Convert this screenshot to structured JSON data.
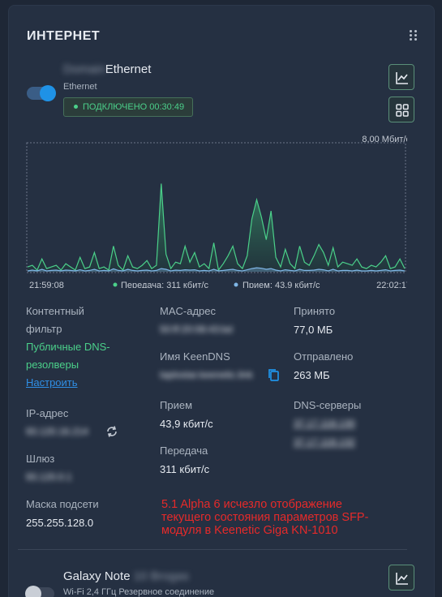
{
  "header": {
    "title": "ИНТЕРНЕТ",
    "menu_icon": "drag-handle-icon"
  },
  "connection": {
    "name_hidden": "Domain",
    "name": "Ethernet",
    "type": "Ethernet",
    "status": "ПОДКЛЮЧЕНО 00:30:49",
    "toggle_on": true,
    "colors": {
      "accent": "#1f92e6",
      "status": "#4bd08a",
      "rx": "#7fb6e6"
    }
  },
  "chart_data": {
    "type": "area",
    "max_label": "8,00 Мбит/с",
    "time_start": "21:59:08",
    "time_end": "22:02:17",
    "legend_tx": "Передача: 311 кбит/с",
    "legend_rx": "Прием: 43,9 кбит/с",
    "series": [
      {
        "name": "Передача",
        "color": "#4bd08a",
        "values": [
          0.3,
          0.4,
          0.1,
          0.8,
          0.2,
          0.3,
          0.4,
          0.1,
          0.5,
          0.3,
          0.1,
          0.9,
          0.2,
          0.3,
          1.2,
          0.2,
          0.3,
          0.1,
          1.6,
          0.4,
          0.1,
          1.0,
          0.3,
          0.2,
          0.4,
          0.7,
          0.2,
          0.4,
          5.5,
          1.1,
          0.2,
          0.6,
          0.5,
          1.6,
          0.6,
          1.2,
          0.3,
          0.5,
          0.2,
          1.8,
          0.1,
          0.5,
          1.0,
          1.6,
          0.5,
          0.2,
          1.0,
          3.3,
          4.5,
          3.4,
          2.0,
          3.8,
          0.9,
          0.3,
          1.4,
          0.5,
          0.2,
          1.6,
          0.6,
          0.4,
          1.0,
          1.7,
          1.2,
          0.4,
          1.5,
          0.3,
          0.6,
          0.5,
          0.4,
          0.8,
          0.3,
          0.2,
          0.4,
          0.3,
          0.6,
          1.0,
          0.2,
          0.3,
          0.8,
          0.2
        ]
      },
      {
        "name": "Прием",
        "color": "#7fb6e6",
        "values": [
          0.05,
          0.1,
          0.05,
          0.15,
          0.05,
          0.08,
          0.1,
          0.05,
          0.1,
          0.08,
          0.05,
          0.12,
          0.05,
          0.08,
          0.15,
          0.05,
          0.08,
          0.05,
          0.18,
          0.08,
          0.05,
          0.15,
          0.08,
          0.05,
          0.08,
          0.1,
          0.05,
          0.08,
          0.2,
          0.15,
          0.05,
          0.1,
          0.08,
          0.12,
          0.1,
          0.12,
          0.05,
          0.08,
          0.05,
          0.15,
          0.05,
          0.08,
          0.12,
          0.15,
          0.08,
          0.05,
          0.12,
          0.2,
          0.25,
          0.22,
          0.15,
          0.2,
          0.1,
          0.05,
          0.12,
          0.08,
          0.05,
          0.15,
          0.08,
          0.08,
          0.1,
          0.15,
          0.12,
          0.05,
          0.15,
          0.05,
          0.08,
          0.08,
          0.05,
          0.1,
          0.05,
          0.05,
          0.08,
          0.05,
          0.08,
          0.12,
          0.05,
          0.08,
          0.1,
          0.05
        ]
      }
    ],
    "ylim": [
      0,
      8
    ]
  },
  "details": {
    "content_filter_label": "Контентный фильтр",
    "content_filter_value": "Публичные DNS-резолверы",
    "configure_link": "Настроить",
    "ip_label": "IP-адрес",
    "ip_value": "93.120.16.214",
    "gateway_label": "Шлюз",
    "gateway_value": "93.120.0.1",
    "mask_label": "Маска подсети",
    "mask_value": "255.255.128.0",
    "mac_label": "MAC-адрес",
    "mac_value": "50:ff:20:08:43:bd",
    "keendns_label": "Имя KeenDNS",
    "keendns_value": "taplostar.keenetic.link",
    "rx_label": "Прием",
    "rx_value": "43,9 кбит/с",
    "tx_label": "Передача",
    "tx_value": "311 кбит/с",
    "received_label": "Принято",
    "received_value": "77,0 МБ",
    "sent_label": "Отправлено",
    "sent_value": "263 МБ",
    "dns_label": "DNS-серверы",
    "dns_1": "37.17.118.130",
    "dns_2": "37.17.118.132"
  },
  "annotation": "5.1 Alpha 6 исчезло отображение\nтекущего состояния параметров SFP-\nмодуля в Keenetic Giga KN-1010",
  "second_connection": {
    "name": "Galaxy Note",
    "name_hidden": "10 Brogas",
    "sub": "Wi-Fi 2,4 ГГц Резервное соединение",
    "toggle_on": false
  }
}
